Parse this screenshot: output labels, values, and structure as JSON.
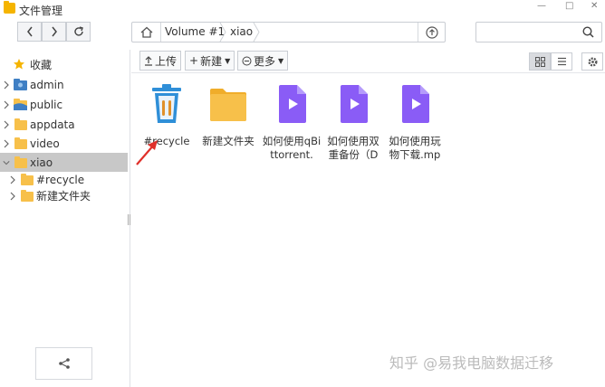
{
  "window": {
    "title": "文件管理"
  },
  "navbar": {
    "breadcrumbs": [
      "Volume #1",
      "xiao"
    ],
    "search": {
      "value": "",
      "placeholder": ""
    }
  },
  "sidebar": {
    "items": [
      {
        "label": "收藏",
        "icon": "star-icon"
      },
      {
        "label": "admin",
        "icon": "user-home-icon"
      },
      {
        "label": "public",
        "icon": "public-folder-icon"
      },
      {
        "label": "appdata",
        "icon": "folder-icon"
      },
      {
        "label": "video",
        "icon": "folder-icon"
      },
      {
        "label": "xiao",
        "icon": "folder-icon",
        "selected": true
      },
      {
        "label": "#recycle",
        "icon": "folder-icon"
      },
      {
        "label": "新建文件夹",
        "icon": "folder-icon"
      }
    ]
  },
  "toolbar": {
    "upload_label": "上传",
    "new_label": "新建",
    "more_label": "更多"
  },
  "files": [
    {
      "name": "#recycle",
      "type": "recycle-bin"
    },
    {
      "name": "新建文件夹",
      "type": "folder"
    },
    {
      "name": "如何使用qBittorrent.",
      "type": "video"
    },
    {
      "name": "如何使用双重备份（D",
      "type": "video"
    },
    {
      "name": "如何使用玩物下载.mp",
      "type": "video"
    }
  ],
  "colors": {
    "accent": "#2f8fd8",
    "folder": "#f7c04a",
    "video": "#8a5cf6",
    "annotation_arrow": "#e0302a"
  },
  "watermark": "知乎 @易我电脑数据迁移"
}
